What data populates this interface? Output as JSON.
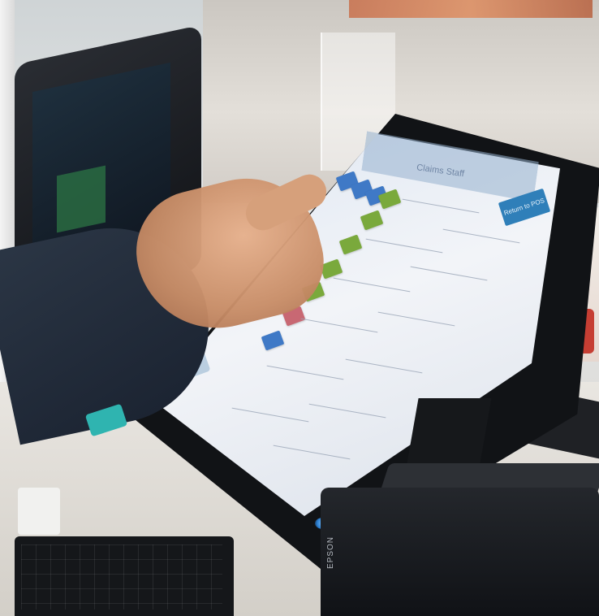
{
  "pos_screen": {
    "header_title": "Claims Staff",
    "return_button": "Return to POS"
  },
  "printer": {
    "brand": "EPSON"
  },
  "colors": {
    "screen_blue": "#2f7fb9",
    "tile_green": "#7aa93c",
    "tile_red": "#c86873",
    "tile_blue": "#3f79c6"
  }
}
